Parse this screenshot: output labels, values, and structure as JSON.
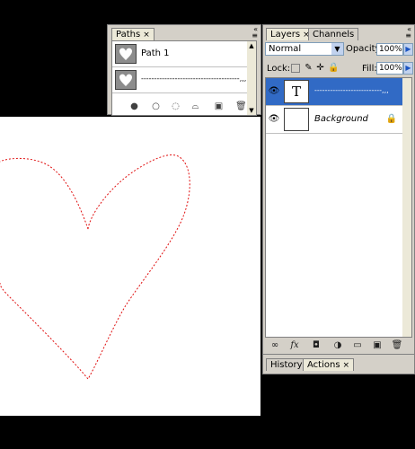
{
  "canvas": {
    "background": "#ffffff",
    "path_color": "#e01010"
  },
  "paths_panel": {
    "tab_label": "Paths",
    "close_glyph": "×",
    "menu_glyph": "≡",
    "rows": [
      {
        "label": "Path 1"
      },
      {
        "label": "--------------------------------------,,,"
      }
    ],
    "footer_icons": [
      "fill-path-icon",
      "stroke-path-icon",
      "load-selection-icon",
      "make-work-path-icon",
      "new-path-icon",
      "delete-path-icon"
    ]
  },
  "layers_panel": {
    "tabs": [
      {
        "label": "Layers",
        "close": "×"
      },
      {
        "label": "Channels"
      }
    ],
    "blend_mode": "Normal",
    "opacity_label": "Opacity:",
    "opacity_value": "100%",
    "lock_label": "Lock:",
    "fill_label": "Fill:",
    "fill_value": "100%",
    "layers": [
      {
        "thumb": "T",
        "name": "--------------------------,,,",
        "selected": true
      },
      {
        "thumb": "",
        "name": "Background",
        "selected": false
      }
    ],
    "footer_icons": [
      "link-layers-icon",
      "fx-icon",
      "add-mask-icon",
      "adjustment-layer-icon",
      "new-group-icon",
      "new-layer-icon",
      "delete-layer-icon"
    ],
    "fx_label": "fx"
  },
  "bottom_tabs": [
    {
      "label": "History"
    },
    {
      "label": "Actions",
      "close": "×"
    }
  ],
  "colors": {
    "panel_bg": "#d4d0c8",
    "selection": "#316ac5",
    "accent": "#1c55c2"
  }
}
